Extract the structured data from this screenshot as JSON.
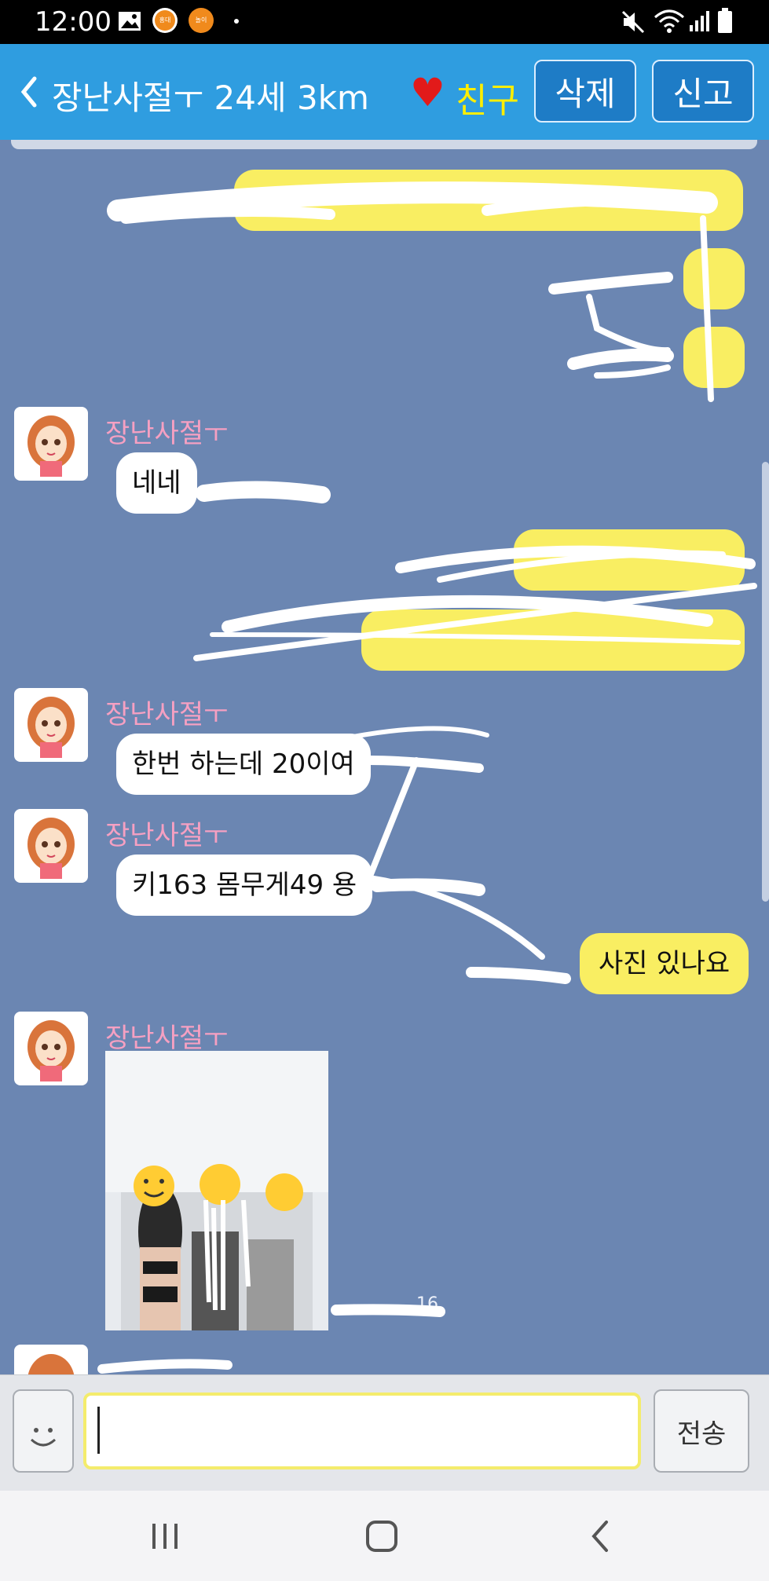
{
  "status_bar": {
    "time": "12:00",
    "left_icons": [
      "image-icon",
      "app-badge-icon",
      "app-badge-icon",
      "dot-icon"
    ],
    "right_icons": [
      "mute-icon",
      "wifi-icon",
      "signal-icon",
      "battery-icon"
    ],
    "app_badge_1": "홍대",
    "app_badge_2": "놀이"
  },
  "header": {
    "back_icon": "chevron-left-icon",
    "title": "장난사절ㅜ 24세 3km",
    "heart": "♥",
    "friend_label": "친구",
    "delete_label": "삭제",
    "report_label": "신고",
    "colors": {
      "bar": "#2f9de0",
      "friend": "#ffee00",
      "heart": "#e21a1a"
    }
  },
  "chat": {
    "colors": {
      "background": "#6b86b2",
      "outgoing": "#f9ee62",
      "incoming": "#ffffff",
      "name": "#f6a0c2"
    },
    "messages": [
      {
        "id": "out-1",
        "direction": "out",
        "text": "",
        "redacted": true
      },
      {
        "id": "out-2",
        "direction": "out",
        "text": "",
        "redacted": true
      },
      {
        "id": "out-3",
        "direction": "out",
        "text": "",
        "redacted": true
      },
      {
        "id": "in-1",
        "direction": "in",
        "sender": "장난사절ㅜ",
        "text": "네네"
      },
      {
        "id": "out-4",
        "direction": "out",
        "text": "",
        "redacted": true
      },
      {
        "id": "out-5",
        "direction": "out",
        "text": "",
        "redacted": true
      },
      {
        "id": "in-2",
        "direction": "in",
        "sender": "장난사절ㅜ",
        "text": "한번 하는데 20이여"
      },
      {
        "id": "in-3",
        "direction": "in",
        "sender": "장난사절ㅜ",
        "text": "키163 몸무게49 용"
      },
      {
        "id": "out-6",
        "direction": "out",
        "text": "사진 있나요"
      },
      {
        "id": "in-4",
        "direction": "in",
        "sender": "장난사절ㅜ",
        "type": "photo",
        "time_fragment": "16"
      }
    ]
  },
  "input_bar": {
    "emoji_icon": "smiley-icon",
    "placeholder": "",
    "value": "",
    "send_label": "전송"
  },
  "nav_bar": {
    "icons": [
      "recent-apps-icon",
      "home-icon",
      "back-icon"
    ]
  }
}
